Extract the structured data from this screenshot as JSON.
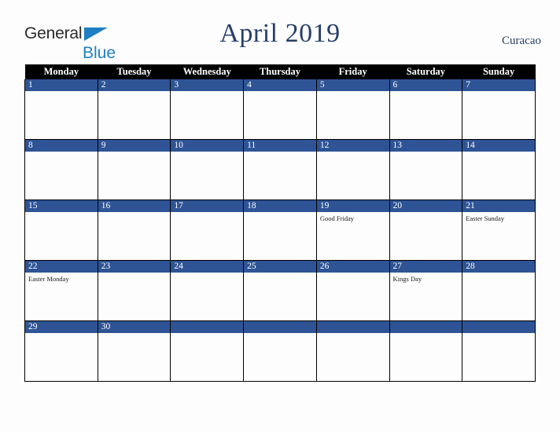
{
  "brand": {
    "name_part1": "General",
    "name_part2": "Blue",
    "triangle_color": "#1f7fc4",
    "text_color": "#2b2b2b"
  },
  "header": {
    "title": "April 2019",
    "location": "Curacao",
    "title_color": "#27406b"
  },
  "calendar": {
    "weekday_headers": [
      "Monday",
      "Tuesday",
      "Wednesday",
      "Thursday",
      "Friday",
      "Saturday",
      "Sunday"
    ],
    "header_bg": "#000000",
    "daynum_band_color": "#2e5496",
    "weeks": [
      [
        {
          "day": "1",
          "events": []
        },
        {
          "day": "2",
          "events": []
        },
        {
          "day": "3",
          "events": []
        },
        {
          "day": "4",
          "events": []
        },
        {
          "day": "5",
          "events": []
        },
        {
          "day": "6",
          "events": []
        },
        {
          "day": "7",
          "events": []
        }
      ],
      [
        {
          "day": "8",
          "events": []
        },
        {
          "day": "9",
          "events": []
        },
        {
          "day": "10",
          "events": []
        },
        {
          "day": "11",
          "events": []
        },
        {
          "day": "12",
          "events": []
        },
        {
          "day": "13",
          "events": []
        },
        {
          "day": "14",
          "events": []
        }
      ],
      [
        {
          "day": "15",
          "events": []
        },
        {
          "day": "16",
          "events": []
        },
        {
          "day": "17",
          "events": []
        },
        {
          "day": "18",
          "events": []
        },
        {
          "day": "19",
          "events": [
            "Good Friday"
          ]
        },
        {
          "day": "20",
          "events": []
        },
        {
          "day": "21",
          "events": [
            "Easter Sunday"
          ]
        }
      ],
      [
        {
          "day": "22",
          "events": [
            "Easter Monday"
          ]
        },
        {
          "day": "23",
          "events": []
        },
        {
          "day": "24",
          "events": []
        },
        {
          "day": "25",
          "events": []
        },
        {
          "day": "26",
          "events": []
        },
        {
          "day": "27",
          "events": [
            "Kings Day"
          ]
        },
        {
          "day": "28",
          "events": []
        }
      ],
      [
        {
          "day": "29",
          "events": []
        },
        {
          "day": "30",
          "events": []
        },
        {
          "day": "",
          "events": []
        },
        {
          "day": "",
          "events": []
        },
        {
          "day": "",
          "events": []
        },
        {
          "day": "",
          "events": []
        },
        {
          "day": "",
          "events": []
        }
      ]
    ]
  }
}
